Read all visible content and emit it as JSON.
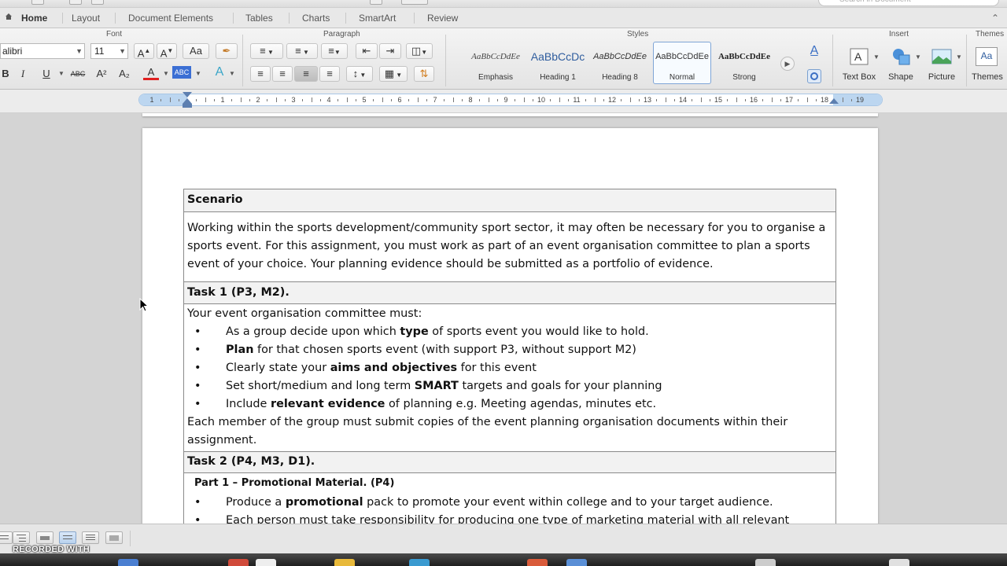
{
  "window": {
    "search_placeholder": "Search in Document"
  },
  "tabs": [
    {
      "label": "Home"
    },
    {
      "label": "Layout"
    },
    {
      "label": "Document Elements"
    },
    {
      "label": "Tables"
    },
    {
      "label": "Charts"
    },
    {
      "label": "SmartArt"
    },
    {
      "label": "Review"
    }
  ],
  "ribbon": {
    "groups": {
      "font": "Font",
      "paragraph": "Paragraph",
      "styles": "Styles",
      "insert": "Insert",
      "themes": "Themes"
    },
    "font_name": "alibri",
    "font_size": "11",
    "font_buttons": {
      "grow": "A",
      "shrink": "A",
      "change_case": "Aa",
      "bold": "B",
      "italic": "I",
      "underline": "U",
      "strikethrough": "ABC",
      "superscript": "A²",
      "subscript": "A₂",
      "font_color": "A",
      "highlight": "ABC",
      "text_effects": "A"
    },
    "styles": [
      {
        "sample": "AaBbCcDdEe",
        "name": "Emphasis"
      },
      {
        "sample": "AaBbCcDc",
        "name": "Heading 1"
      },
      {
        "sample": "AaBbCcDdEe",
        "name": "Heading 8"
      },
      {
        "sample": "AaBbCcDdEe",
        "name": "Normal"
      },
      {
        "sample": "AaBbCcDdEe",
        "name": "Strong"
      }
    ],
    "insert": [
      {
        "name": "Text Box"
      },
      {
        "name": "Shape"
      },
      {
        "name": "Picture"
      }
    ],
    "themes_label": "Themes",
    "themes_sample": "Aa"
  },
  "ruler": {
    "labels": [
      "1",
      "1",
      "2",
      "3",
      "4",
      "5",
      "6",
      "7",
      "8",
      "9",
      "10",
      "11",
      "12",
      "13",
      "14",
      "15",
      "16",
      "17",
      "18",
      "19"
    ]
  },
  "document": {
    "scenario": {
      "heading": "Scenario",
      "body": "Working within the sports development/community sport sector, it may often be necessary for you to organise a sports event.  For this assignment, you must work as part of an event organisation committee to plan a sports event of your choice. Your planning evidence should be submitted as a portfolio of evidence."
    },
    "task1": {
      "heading": "Task 1 (P3, M2).",
      "intro": "Your event organisation committee must:",
      "bullet_char": "•",
      "bullets": [
        {
          "pre": "As a group decide upon which ",
          "bold": "type",
          "post": " of sports event you would like to hold."
        },
        {
          "pre": "",
          "bold": "Plan",
          "post": " for that chosen sports event (with support P3, without support M2)"
        },
        {
          "pre": "Clearly state your ",
          "bold": "aims and objectives",
          "post": " for this event"
        },
        {
          "pre": "Set short/medium and long term ",
          "bold": "SMART",
          "post": " targets and goals for your planning"
        },
        {
          "pre": "Include ",
          "bold": "relevant evidence",
          "post": " of planning e.g. Meeting agendas, minutes etc."
        }
      ],
      "outro": "Each member of the group must submit copies of the event planning organisation documents within their assignment."
    },
    "task2": {
      "heading": "Task 2 (P4, M3, D1).",
      "part1": "Part 1 – Promotional Material.  (P4)",
      "bullets": [
        {
          "pre": "Produce a ",
          "bold": "promotional",
          "post": " pack to promote your event within college and to your target audience."
        },
        {
          "pre": "Each person must take responsibility for producing one type of marketing material with all relevant",
          "bold": "",
          "post": ""
        }
      ]
    }
  },
  "overlay": {
    "watermark": "RECORDED WITH"
  }
}
